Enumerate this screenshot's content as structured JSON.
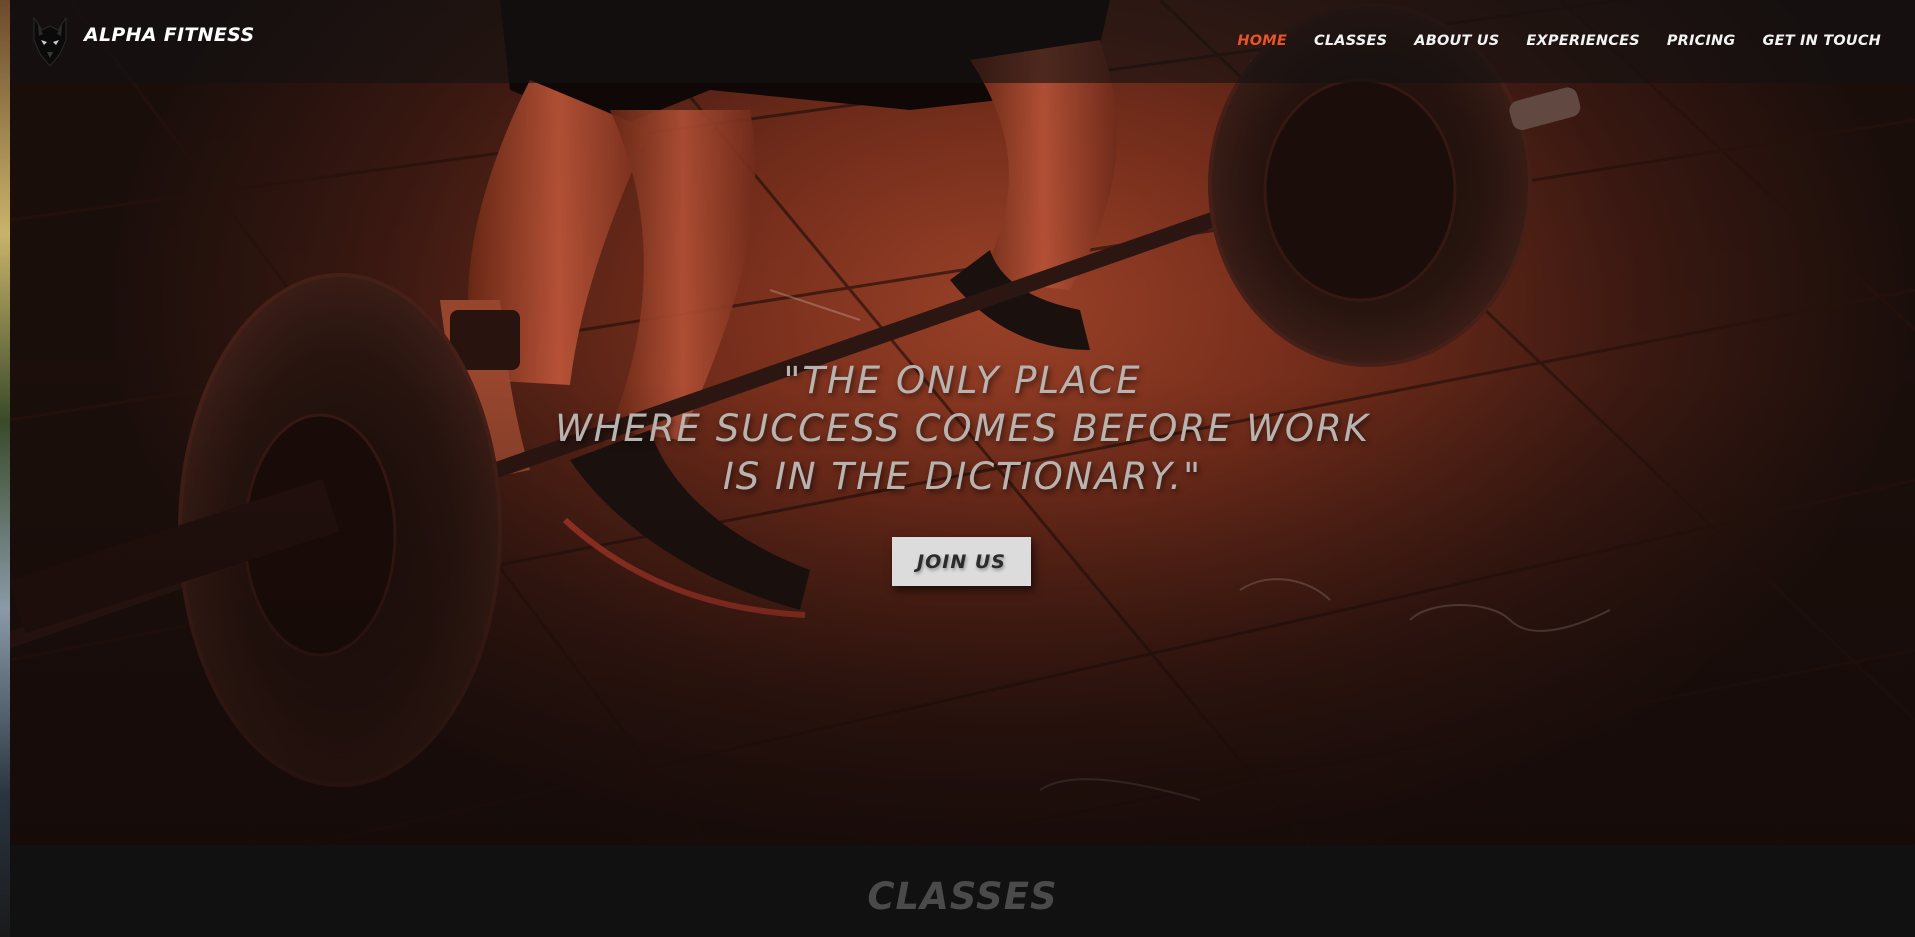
{
  "brand": {
    "name": "ALPHA FITNESS",
    "logo_icon": "wolf-icon"
  },
  "nav": {
    "items": [
      {
        "label": "HOME",
        "active": true
      },
      {
        "label": "CLASSES",
        "active": false
      },
      {
        "label": "ABOUT US",
        "active": false
      },
      {
        "label": "EXPERIENCES",
        "active": false
      },
      {
        "label": "PRICING",
        "active": false
      },
      {
        "label": "GET IN TOUCH",
        "active": false
      }
    ],
    "active_color": "#e8532a"
  },
  "hero": {
    "quote_lines": [
      "\"THE ONLY PLACE",
      "WHERE SUCCESS COMES BEFORE WORK",
      "IS IN THE DICTIONARY.\""
    ],
    "cta_label": "JOIN US"
  },
  "classes": {
    "title": "CLASSES"
  }
}
